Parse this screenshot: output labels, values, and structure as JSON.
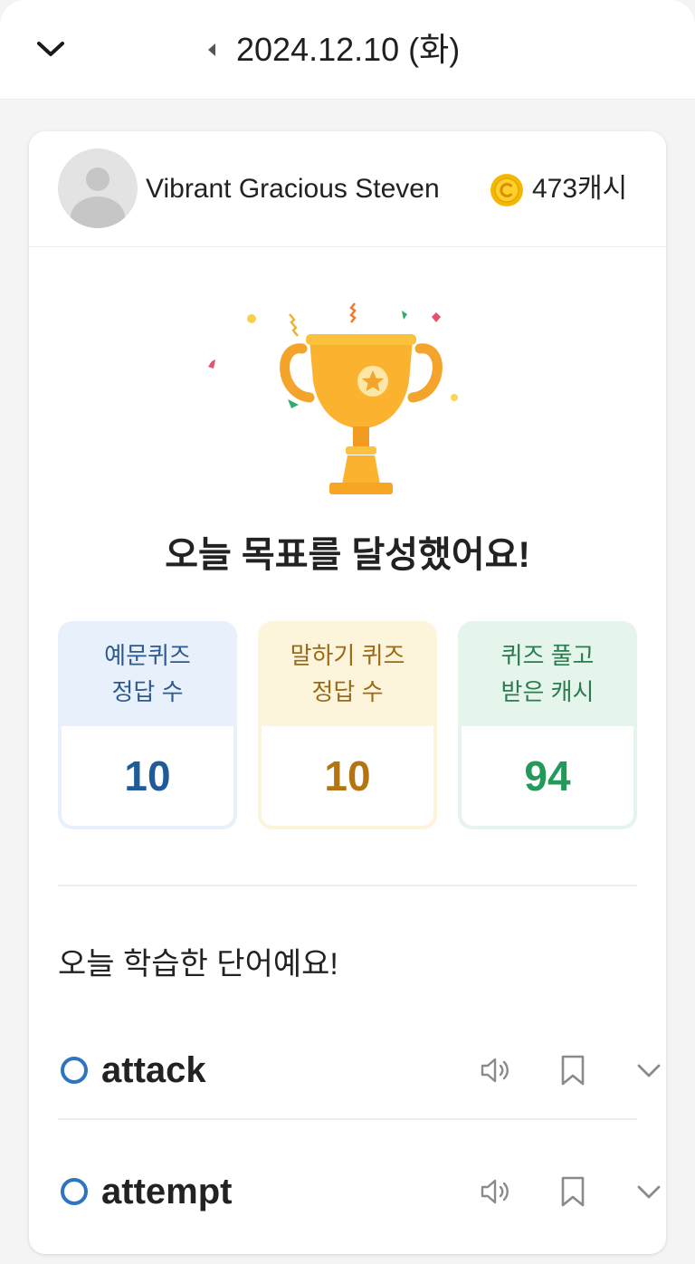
{
  "header": {
    "date": "2024.12.10 (화)"
  },
  "profile": {
    "name": "Vibrant Gracious Steven",
    "cash": "473캐시"
  },
  "headline": "오늘 목표를 달성했어요!",
  "stats": [
    {
      "label_line1": "예문퀴즈",
      "label_line2": "정답 수",
      "value": "10"
    },
    {
      "label_line1": "말하기 퀴즈",
      "label_line2": "정답 수",
      "value": "10"
    },
    {
      "label_line1": "퀴즈 풀고",
      "label_line2": "받은 캐시",
      "value": "94"
    }
  ],
  "section_title": "오늘 학습한 단어예요!",
  "words": [
    {
      "word": "attack"
    },
    {
      "word": "attempt"
    }
  ],
  "icons": {
    "collapse": "chevron-down-icon",
    "prev": "caret-left-icon",
    "coin": "coin-icon",
    "speaker": "speaker-icon",
    "bookmark": "bookmark-icon",
    "expand": "chevron-down-icon"
  },
  "colors": {
    "status_circle": "#2e74c0",
    "trophy": "#fbb22e",
    "coin": "#f5b800"
  }
}
